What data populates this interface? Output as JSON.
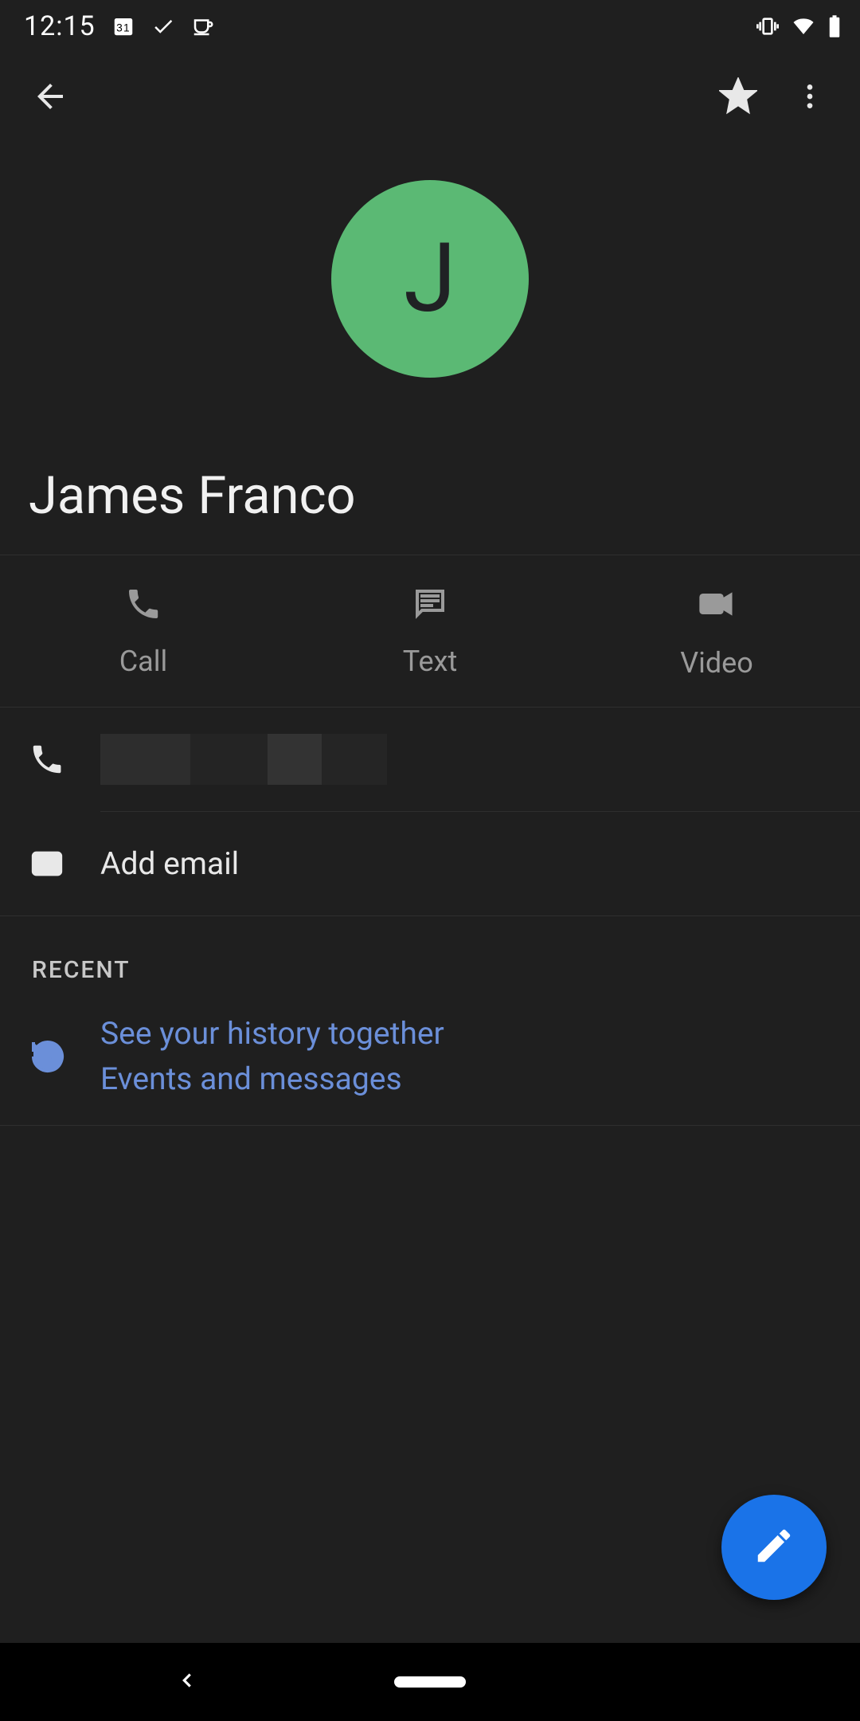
{
  "status": {
    "time": "12:15",
    "calendar_day": "31"
  },
  "toolbar": {
    "back": "Back",
    "star": "Favorite",
    "more": "More options"
  },
  "contact": {
    "avatar_initial": "J",
    "avatar_color": "#5bb974",
    "name": "James Franco"
  },
  "actions": {
    "call": "Call",
    "text": "Text",
    "video": "Video"
  },
  "details": {
    "phone_value_redacted": true,
    "add_email": "Add email"
  },
  "recent": {
    "header": "RECENT",
    "history_line1": "See your history together",
    "history_line2": "Events and messages"
  },
  "fab": {
    "label": "Edit contact"
  },
  "colors": {
    "accent_link": "#6b8fd9",
    "fab": "#1a73e8"
  }
}
